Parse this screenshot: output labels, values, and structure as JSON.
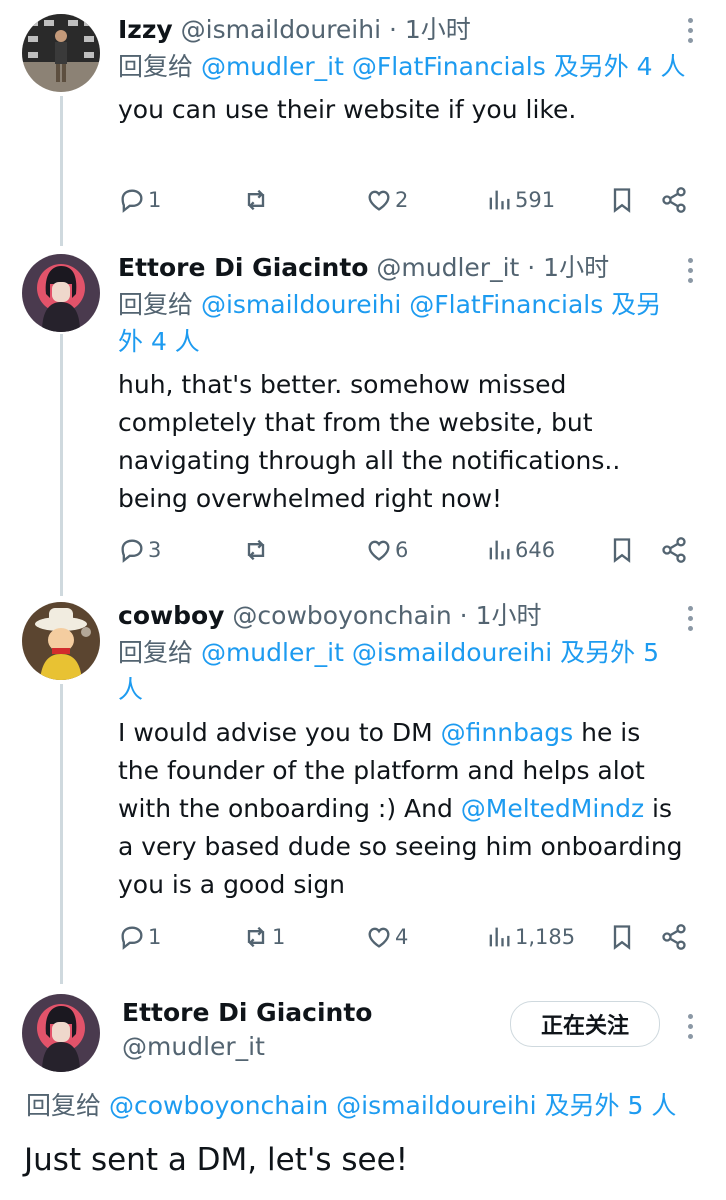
{
  "tweets": [
    {
      "name": "Izzy",
      "handle": "@ismaildoureihi",
      "dot": " · ",
      "time": "1小时",
      "reply_prefix": "回复给 ",
      "reply_mentions": "@mudler_it @FlatFinancials 及另外 4 人",
      "text": "you can use their website if you like.",
      "replies": "1",
      "retweets": "",
      "likes": "2",
      "views": "591"
    },
    {
      "name": "Ettore Di Giacinto",
      "handle": "@mudler_it",
      "dot": " · ",
      "time": "1小时",
      "reply_prefix": "回复给 ",
      "reply_mentions": "@ismaildoureihi @FlatFinancials 及另外 4 人",
      "text": "huh, that's better. somehow missed completely that from the website, but navigating through all the notifications.. being overwhelmed right now!",
      "replies": "3",
      "retweets": "",
      "likes": "6",
      "views": "646"
    },
    {
      "name": "cowboy",
      "handle": "@cowboyonchain",
      "dot": " · ",
      "time": "1小时",
      "reply_prefix": "回复给 ",
      "reply_mentions": "@mudler_it @ismaildoureihi 及另外 5 人",
      "text_parts": [
        "I would advise you to DM ",
        "@finnbags",
        " he is the founder of the platform and helps alot with the onboarding :) And ",
        "@MeltedMindz",
        " is a very based dude so seeing him onboarding you is a good sign"
      ],
      "replies": "1",
      "retweets": "1",
      "likes": "4",
      "views": "1,185"
    }
  ],
  "main_tweet": {
    "name": "Ettore Di Giacinto",
    "handle": "@mudler_it",
    "follow_label": "正在关注",
    "reply_prefix": "回复给 ",
    "reply_mentions": "@cowboyonchain @ismaildoureihi 及另外 5 人",
    "text": "Just sent a DM, let's see!"
  },
  "colors": {
    "link": "#1d9bf0",
    "muted": "#536471",
    "text": "#0f1419",
    "thread_line": "#cfd9de"
  },
  "icons": [
    "reply-icon",
    "retweet-icon",
    "like-icon",
    "views-icon",
    "bookmark-icon",
    "share-icon",
    "more-icon"
  ]
}
